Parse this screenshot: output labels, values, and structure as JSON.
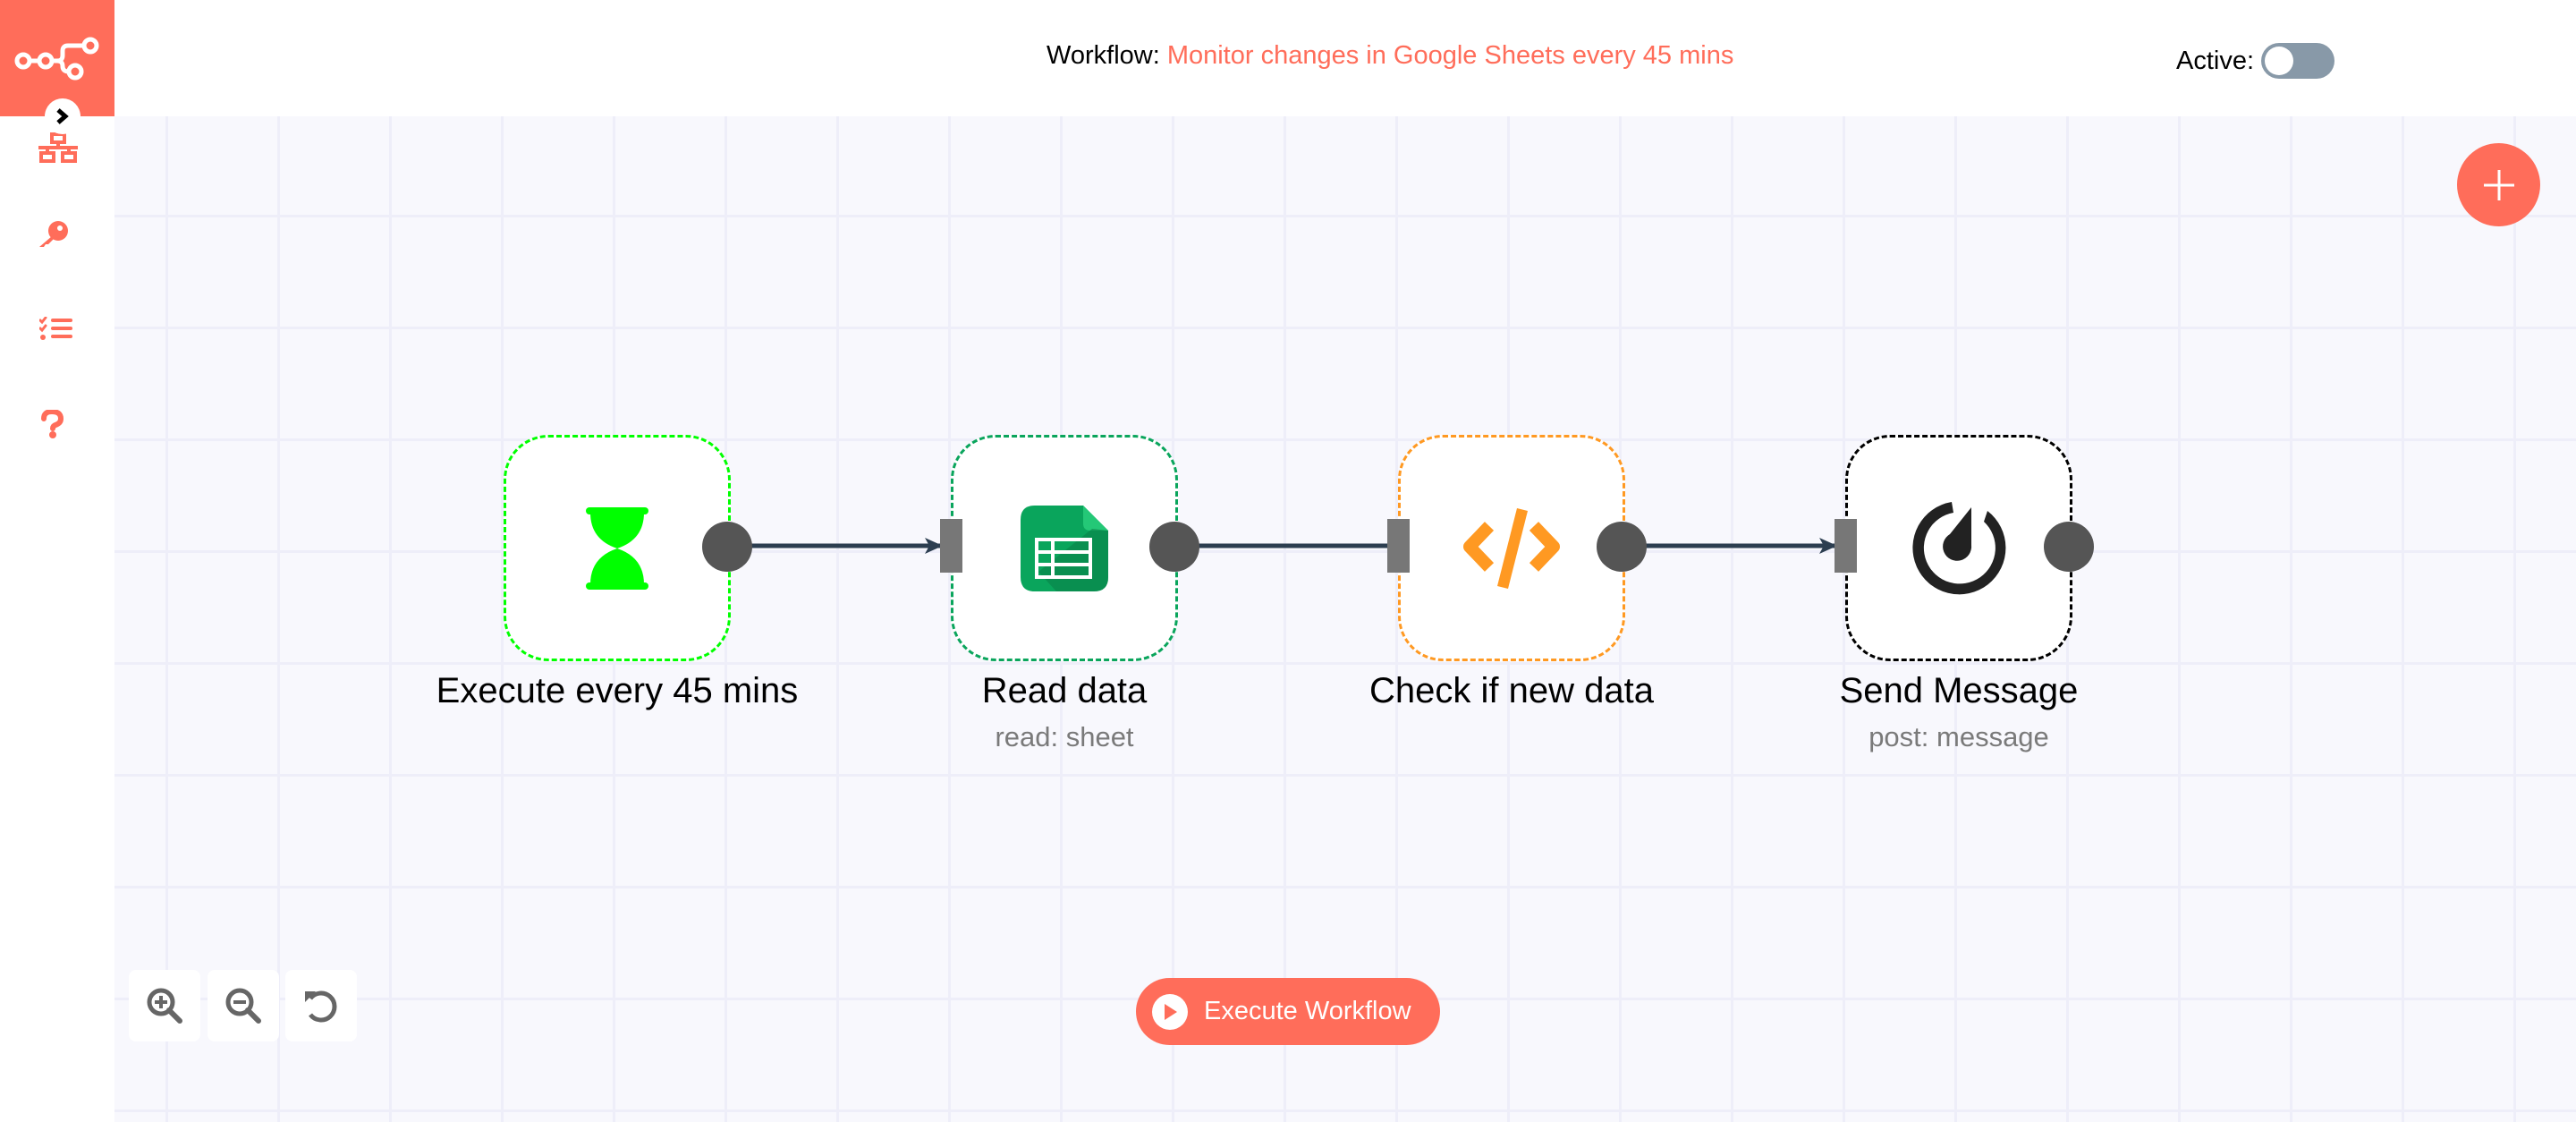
{
  "header": {
    "workflow_prefix": "Workflow:",
    "workflow_name": "Monitor changes in Google Sheets every 45 mins",
    "active_label": "Active:",
    "active": false
  },
  "sidebar": {
    "logo_icon": "n8n-logo-icon",
    "collapse_icon": "chevron-right-icon",
    "items": [
      {
        "id": "workflows",
        "icon": "network-icon"
      },
      {
        "id": "credentials",
        "icon": "key-icon"
      },
      {
        "id": "executions",
        "icon": "tasks-list-icon"
      },
      {
        "id": "help",
        "icon": "question-icon"
      }
    ]
  },
  "colors": {
    "brand": "#ff6d5a",
    "canvas_bg": "#f8f8fd",
    "grid": "#eeeef9",
    "edge": "#2c3e50",
    "handle_out": "#555555",
    "handle_in": "#777777",
    "toggle_off": "#8899a8"
  },
  "nodes": [
    {
      "name": "Execute every 45 mins",
      "subtitle": "",
      "icon": "hourglass-icon",
      "border_color": "#00ff00"
    },
    {
      "name": "Read data",
      "subtitle": "read: sheet",
      "icon": "google-sheets-icon",
      "border_color": "#0aa55c"
    },
    {
      "name": "Check if new data",
      "subtitle": "",
      "icon": "code-icon",
      "border_color": "#ff9922"
    },
    {
      "name": "Send Message",
      "subtitle": "post: message",
      "icon": "mattermost-icon",
      "border_color": "#000000"
    }
  ],
  "connections": [
    {
      "from": 0,
      "to": 1,
      "arrow": true
    },
    {
      "from": 1,
      "to": 2,
      "arrow": false
    },
    {
      "from": 2,
      "to": 3,
      "arrow": true
    }
  ],
  "controls": {
    "zoom_in_icon": "zoom-in-icon",
    "zoom_out_icon": "zoom-out-icon",
    "reset_icon": "reset-zoom-icon",
    "add_node_icon": "plus-icon"
  },
  "execute_button": {
    "label": "Execute Workflow",
    "icon": "play-icon"
  }
}
